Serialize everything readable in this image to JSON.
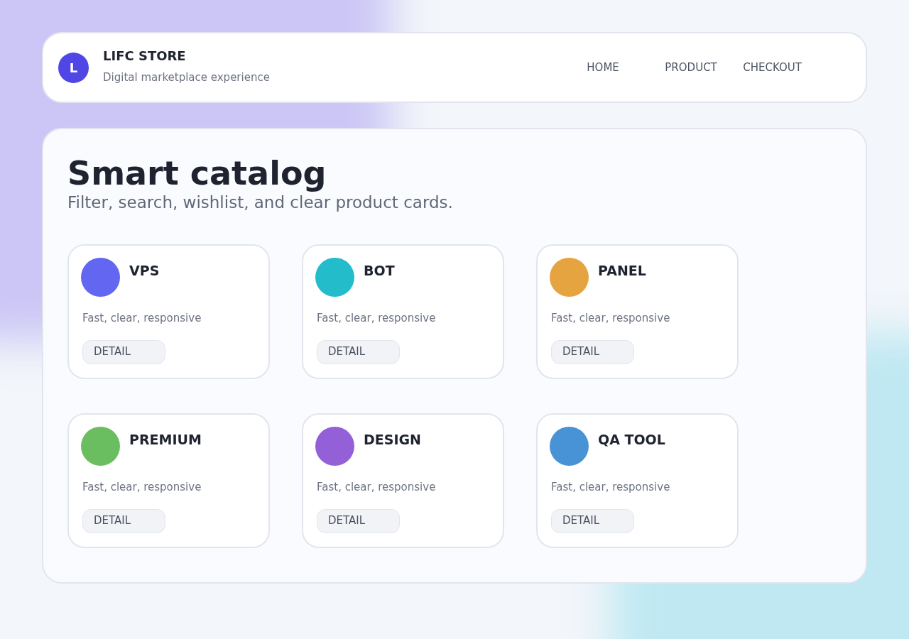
{
  "header": {
    "logo_letter": "L",
    "title": "LIFC STORE",
    "subtitle": "Digital marketplace experience",
    "nav": [
      {
        "label": "HOME"
      },
      {
        "label": "PRODUCT"
      },
      {
        "label": "CHECKOUT"
      }
    ]
  },
  "catalog": {
    "title": "Smart catalog",
    "subtitle": "Filter, search, wishlist, and clear product cards.",
    "products": [
      {
        "name": "VPS",
        "color": "#6366f1",
        "description": "Fast, clear, responsive",
        "button": "DETAIL"
      },
      {
        "name": "BOT",
        "color": "#22bccb",
        "description": "Fast, clear, responsive",
        "button": "DETAIL"
      },
      {
        "name": "PANEL",
        "color": "#e5a43f",
        "description": "Fast, clear, responsive",
        "button": "DETAIL"
      },
      {
        "name": "PREMIUM",
        "color": "#6abe5f",
        "description": "Fast, clear, responsive",
        "button": "DETAIL"
      },
      {
        "name": "DESIGN",
        "color": "#9360d8",
        "description": "Fast, clear, responsive",
        "button": "DETAIL"
      },
      {
        "name": "QA TOOL",
        "color": "#4893d6",
        "description": "Fast, clear, responsive",
        "button": "DETAIL"
      }
    ]
  }
}
